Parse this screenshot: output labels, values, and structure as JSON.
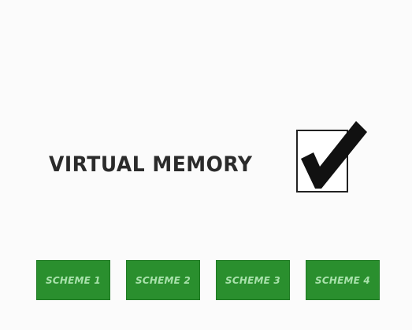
{
  "option": {
    "label": "VIRTUAL MEMORY",
    "checked": true
  },
  "icons": {
    "checkmark": "checkmark-icon"
  },
  "colors": {
    "background": "#fbfbfb",
    "label_text": "#2b2b2b",
    "checkmark": "#111111",
    "button_fill": "#2a8f2e",
    "button_text": "#a9e2ac"
  },
  "schemes": [
    {
      "label": "SCHEME 1"
    },
    {
      "label": "SCHEME 2"
    },
    {
      "label": "SCHEME 3"
    },
    {
      "label": "SCHEME 4"
    }
  ]
}
